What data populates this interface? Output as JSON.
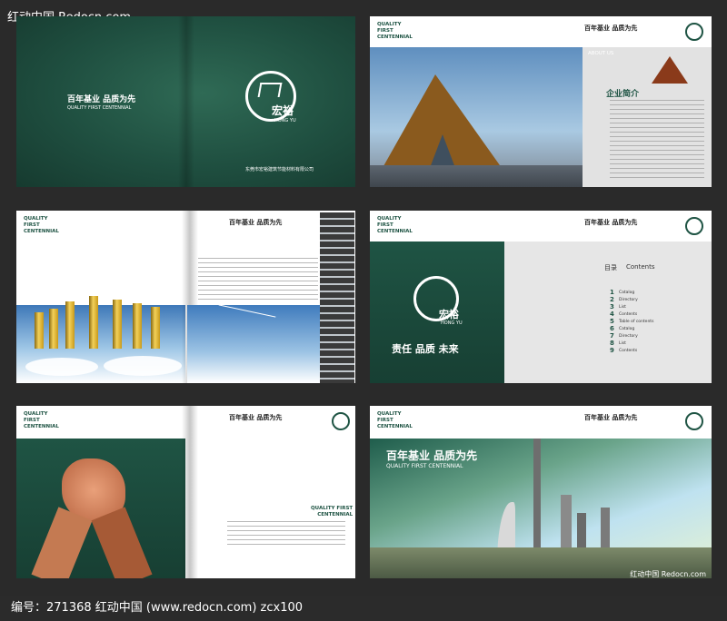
{
  "watermark_top": "红动中国 Redocn.com",
  "watermark_bottom_right": "红动中国 Redocn.com",
  "footer": "编号：271368    红动中国 (www.redocn.com)    zcx100",
  "brand": {
    "slogan_cn": "百年基业  品质为先",
    "slogan_en": "QUALITY FIRST CENTENNIAL",
    "logo_cn": "宏裕",
    "logo_en": "HONG YU",
    "company_cn": "东莞市宏裕建筑节能材料有限公司",
    "values_cn": "责任  品质  未来"
  },
  "quality_first": {
    "line1": "QUALITY",
    "line2": "FIRST",
    "line3": "CENTENNIAL"
  },
  "quality_first_inline": {
    "line1": "QUALITY FIRST",
    "line2": "CENTENNIAL"
  },
  "about": {
    "en": "ABOUT US",
    "cn": "企业简介"
  },
  "contents": {
    "title_cn": "目录",
    "title_en": "Contents",
    "items": [
      {
        "n": "1",
        "label": "Catalog"
      },
      {
        "n": "2",
        "label": "Directory"
      },
      {
        "n": "3",
        "label": "List"
      },
      {
        "n": "4",
        "label": "Contents"
      },
      {
        "n": "5",
        "label": "Table of contents"
      },
      {
        "n": "6",
        "label": "Catalog"
      },
      {
        "n": "7",
        "label": "Directory"
      },
      {
        "n": "8",
        "label": "List"
      },
      {
        "n": "9",
        "label": "Contents"
      }
    ]
  },
  "colors": {
    "brand_green": "#1f5444",
    "gold": "#e7c24a"
  }
}
